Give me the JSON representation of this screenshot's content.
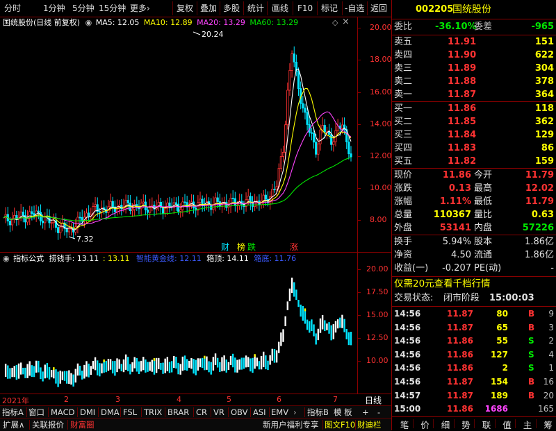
{
  "toolbar": {
    "left": [
      "分时",
      "1分钟",
      "5分钟",
      "15分钟",
      "更多"
    ],
    "more_arrow": "›",
    "right": [
      "复权",
      "叠加",
      "多股",
      "统计",
      "画线",
      "F10",
      "标记",
      "-自选",
      "返回"
    ]
  },
  "main_chart": {
    "title": "国统股份(日线 前复权)",
    "ma": [
      {
        "label": "MA5: 12.05",
        "color": "#ffffff"
      },
      {
        "label": "MA10: 12.89",
        "color": "#ffff00"
      },
      {
        "label": "MA20: 13.29",
        "color": "#ff44ff"
      },
      {
        "label": "MA60: 13.29",
        "color": "#00e600"
      }
    ],
    "high_marker": "20.24",
    "low_marker": "7.32",
    "tags": [
      {
        "text": "财",
        "color": "#00e5ff"
      },
      {
        "text": "榜",
        "color": "#ffff00"
      },
      {
        "text": "跌",
        "color": "#00e600"
      },
      {
        "text": "涨",
        "color": "#ff3232"
      }
    ],
    "y_ticks": [
      "20.00",
      "18.00",
      "16.00",
      "14.00",
      "12.00",
      "10.00",
      "8.00"
    ]
  },
  "indicator": {
    "name": "指标公式",
    "items": [
      {
        "label": "捞钱手: 13.11",
        "color": "#ffffff"
      },
      {
        "label": ": 13.11",
        "color": "#ffff00"
      },
      {
        "label": "智能黄金线: 12.11",
        "color": "#3c5aff"
      },
      {
        "label": "箱顶: 14.11",
        "color": "#ffffff"
      },
      {
        "label": "箱底: 11.76",
        "color": "#3c5aff"
      }
    ],
    "y_ticks": [
      "20.00",
      "17.50",
      "15.00",
      "12.50",
      "10.00"
    ]
  },
  "time_axis": {
    "labels": [
      "2021年",
      "2",
      "3",
      "4",
      "5",
      "6",
      "7"
    ],
    "right_label": "日线"
  },
  "tabs_row1": [
    "指标A",
    "窗口",
    "MACD",
    "DMI",
    "DMA",
    "FSL",
    "TRIX",
    "BRAR",
    "CR",
    "VR",
    "OBV",
    "ASI",
    "EMV"
  ],
  "tabs_row1_right": [
    "指标B",
    "模 板",
    "+",
    "-"
  ],
  "tabs_row2": [
    "扩展∧",
    "关联报价",
    "财富圈"
  ],
  "tabs_row2_right": [
    "新用户福利专享",
    "图文F10",
    "财迪栏"
  ],
  "quote": {
    "code": "002205",
    "name": "国统股份",
    "weibi_label": "委比",
    "weibi": "-36.10%",
    "weicha_label": "委差",
    "weicha": "-965",
    "asks": [
      {
        "label": "卖五",
        "price": "11.91",
        "vol": "151"
      },
      {
        "label": "卖四",
        "price": "11.90",
        "vol": "622"
      },
      {
        "label": "卖三",
        "price": "11.89",
        "vol": "304"
      },
      {
        "label": "卖二",
        "price": "11.88",
        "vol": "378"
      },
      {
        "label": "卖一",
        "price": "11.87",
        "vol": "364"
      }
    ],
    "bids": [
      {
        "label": "买一",
        "price": "11.86",
        "vol": "118"
      },
      {
        "label": "买二",
        "price": "11.85",
        "vol": "362"
      },
      {
        "label": "买三",
        "price": "11.84",
        "vol": "129"
      },
      {
        "label": "买四",
        "price": "11.83",
        "vol": "86"
      },
      {
        "label": "买五",
        "price": "11.82",
        "vol": "159"
      }
    ],
    "stats": [
      {
        "l1": "现价",
        "v1": "11.86",
        "l2": "今开",
        "v2": "11.79",
        "c1": "#ff3232",
        "c2": "#ff3232"
      },
      {
        "l1": "涨跌",
        "v1": "0.13",
        "l2": "最高",
        "v2": "12.02",
        "c1": "#ff3232",
        "c2": "#ff3232"
      },
      {
        "l1": "涨幅",
        "v1": "1.11%",
        "l2": "最低",
        "v2": "11.79",
        "c1": "#ff3232",
        "c2": "#ff3232"
      },
      {
        "l1": "总量",
        "v1": "110367",
        "l2": "量比",
        "v2": "0.63",
        "c1": "#ffff00",
        "c2": "#ffff00"
      },
      {
        "l1": "外盘",
        "v1": "53141",
        "l2": "内盘",
        "v2": "57226",
        "c1": "#ff3232",
        "c2": "#00e600"
      }
    ],
    "fund": [
      {
        "l1": "换手",
        "v1": "5.94%",
        "l2": "股本",
        "v2": "1.86亿"
      },
      {
        "l1": "净资",
        "v1": "4.50",
        "l2": "流通",
        "v2": "1.86亿"
      },
      {
        "l1": "收益(一)",
        "v1": "-0.207",
        "l2": "PE(动)",
        "v2": "-"
      }
    ],
    "promo": "仅需20元查看千档行情",
    "status_label": "交易状态:",
    "status": "闭市阶段",
    "status_time": "15:00:03",
    "ticks": [
      {
        "t": "14:56",
        "p": "11.87",
        "v": "80",
        "d": "B",
        "n": "9",
        "pc": "#ff3232",
        "dc": "#ff3232"
      },
      {
        "t": "14:56",
        "p": "11.87",
        "v": "65",
        "d": "B",
        "n": "3",
        "pc": "#ff3232",
        "dc": "#ff3232"
      },
      {
        "t": "14:56",
        "p": "11.86",
        "v": "55",
        "d": "S",
        "n": "2",
        "pc": "#ff3232",
        "dc": "#00e600"
      },
      {
        "t": "14:56",
        "p": "11.86",
        "v": "127",
        "d": "S",
        "n": "4",
        "pc": "#ff3232",
        "dc": "#00e600"
      },
      {
        "t": "14:56",
        "p": "11.86",
        "v": "2",
        "d": "S",
        "n": "1",
        "pc": "#ff3232",
        "dc": "#00e600"
      },
      {
        "t": "14:56",
        "p": "11.87",
        "v": "154",
        "d": "B",
        "n": "16",
        "pc": "#ff3232",
        "dc": "#ff3232"
      },
      {
        "t": "14:57",
        "p": "11.87",
        "v": "189",
        "d": "B",
        "n": "20",
        "pc": "#ff3232",
        "dc": "#ff3232"
      },
      {
        "t": "15:00",
        "p": "11.86",
        "v": "1686",
        "d": "",
        "n": "165",
        "pc": "#ff3232",
        "dc": "#ff3232"
      }
    ],
    "bottom_tabs": [
      "笔",
      "价",
      "细",
      "势",
      "联",
      "值",
      "主",
      "筹"
    ]
  }
}
